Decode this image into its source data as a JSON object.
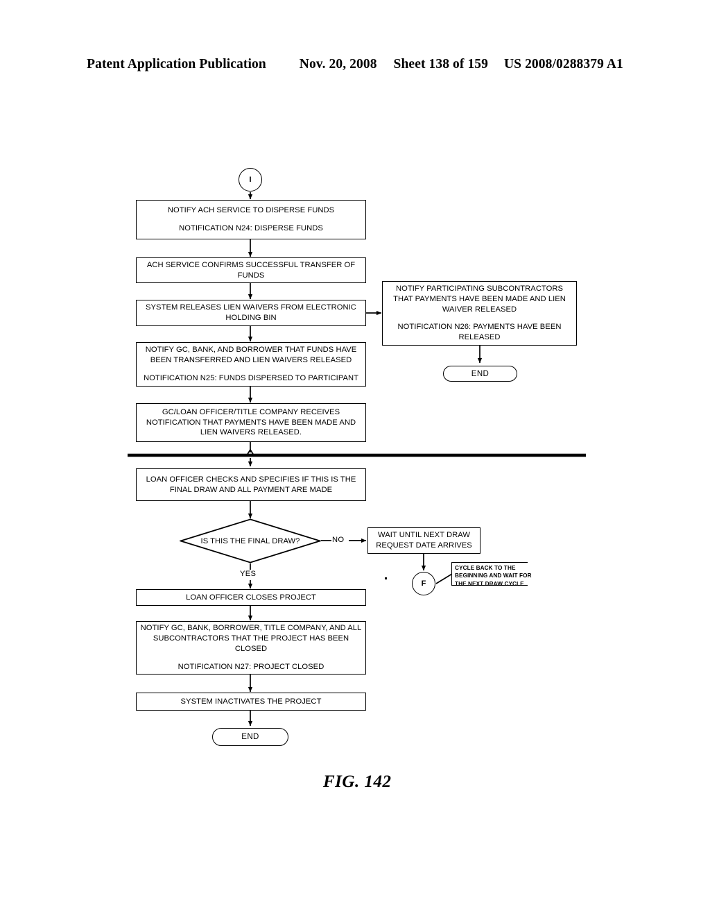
{
  "header": {
    "publication": "Patent Application Publication",
    "date": "Nov. 20, 2008",
    "sheet": "Sheet 138 of 159",
    "patent_number": "US 2008/0288379 A1"
  },
  "figure": {
    "caption": "FIG. 142"
  },
  "flowchart": {
    "connector_in": {
      "label": "I"
    },
    "connector_f": {
      "label": "F"
    },
    "nodes": {
      "notify_ach": {
        "line1": "NOTIFY ACH SERVICE TO DISPERSE FUNDS",
        "line2": "NOTIFICATION N24: DISPERSE FUNDS"
      },
      "ach_confirms": {
        "line1": "ACH SERVICE CONFIRMS SUCCESSFUL TRANSFER OF",
        "line2": "FUNDS"
      },
      "system_releases": {
        "line1": "SYSTEM RELEASES LIEN WAIVERS FROM ELECTRONIC",
        "line2": "HOLDING BIN"
      },
      "notify_gc_bank_borrower": {
        "line1": "NOTIFY GC, BANK, AND BORROWER THAT FUNDS HAVE",
        "line2": "BEEN TRANSFERRED AND LIEN WAIVERS RELEASED",
        "line3": "NOTIFICATION N25: FUNDS DISPERSED TO PARTICIPANT"
      },
      "gc_loan_officer_receives": {
        "line1": "GC/LOAN OFFICER/TITLE COMPANY RECEIVES",
        "line2": "NOTIFICATION THAT PAYMENTS HAVE BEEN MADE AND",
        "line3": "LIEN WAIVERS RELEASED."
      },
      "notify_subcontractors": {
        "line1": "NOTIFY PARTICIPATING SUBCONTRACTORS",
        "line2": "THAT PAYMENTS HAVE BEEN MADE AND LIEN",
        "line3": "WAIVER RELEASED",
        "line4": "NOTIFICATION N26: PAYMENTS HAVE BEEN",
        "line5": "RELEASED"
      },
      "end_top": {
        "label": "END"
      },
      "loan_officer_checks": {
        "line1": "LOAN OFFICER CHECKS AND SPECIFIES IF THIS IS THE",
        "line2": "FINAL DRAW AND ALL PAYMENT ARE MADE"
      },
      "is_final_draw": {
        "label": "IS THIS THE FINAL DRAW?"
      },
      "wait_next_draw": {
        "line1": "WAIT UNTIL NEXT DRAW",
        "line2": "REQUEST DATE ARRIVES"
      },
      "cycle_back_note": {
        "line1": "CYCLE BACK TO THE",
        "line2": "BEGINNING AND WAIT FOR",
        "line3": "THE NEXT DRAW CYCLE"
      },
      "loan_officer_closes": {
        "label": "LOAN OFFICER CLOSES PROJECT"
      },
      "notify_project_closed": {
        "line1": "NOTIFY GC, BANK, BORROWER, TITLE COMPANY, AND ALL",
        "line2": "SUBCONTRACTORS THAT THE PROJECT HAS BEEN",
        "line3": "CLOSED",
        "line4": "NOTIFICATION N27: PROJECT CLOSED"
      },
      "system_inactivates": {
        "label": "SYSTEM INACTIVATES THE PROJECT"
      },
      "end_bottom": {
        "label": "END"
      }
    },
    "edges": {
      "no_label": "NO",
      "yes_label": "YES"
    }
  }
}
